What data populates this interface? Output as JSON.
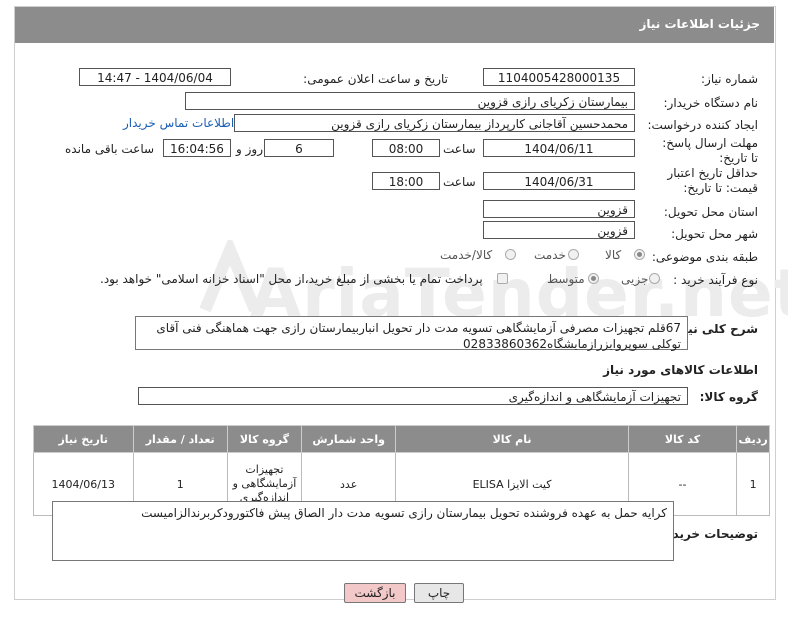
{
  "header": {
    "title": "جزئیات اطلاعات نیاز"
  },
  "watermark": "AriaTender.net",
  "form": {
    "need_number_label": "شماره نیاز:",
    "need_number": "1104005428000135",
    "announce_label": "تاریخ و ساعت اعلان عمومی:",
    "announce_value": "1404/06/04 - 14:47",
    "buyer_org_label": "نام دستگاه خریدار:",
    "buyer_org": "بیمارستان زکریای رازی قزوین",
    "creator_label": "ایجاد کننده درخواست:",
    "creator": "محمدحسین آقاجانی کارپرداز بیمارستان زکریای رازی قزوین",
    "contact_link": "اطلاعات تماس خریدار",
    "reply_deadline_label": "مهلت ارسال پاسخ: تا تاریخ:",
    "reply_date": "1404/06/11",
    "time_label": "ساعت",
    "reply_time": "08:00",
    "days_value": "6",
    "days_label": "روز و",
    "remaining_time": "16:04:56",
    "remaining_label": "ساعت باقی مانده",
    "price_deadline_label": "حداقل تاریخ اعتبار قیمت: تا تاریخ:",
    "price_date": "1404/06/31",
    "price_time": "18:00",
    "province_label": "استان محل تحویل:",
    "province": "قزوین",
    "city_label": "شهر محل تحویل:",
    "city": "قزوین",
    "category_label": "طبقه بندی موضوعی:",
    "category_options": [
      "کالا",
      "خدمت",
      "کالا/خدمت"
    ],
    "process_label": "نوع فرآیند خرید :",
    "process_options": [
      "جزیی",
      "متوسط"
    ],
    "payment_note": "پرداخت تمام یا بخشی از مبلغ خرید،از محل \"اسناد خزانه اسلامی\" خواهد بود."
  },
  "description": {
    "label": "شرح کلی نیاز:",
    "text": "67قلم تجهیزات مصرفی آزمایشگاهی تسویه مدت دار تحویل  انباربیمارستان رازی جهت هماهنگی فنی آقای توکلی سوپروایزرازمایشگاه02833860362"
  },
  "goods_info": {
    "section_title": "اطلاعات کالاهای مورد نیاز",
    "group_label": "گروه کالا:",
    "group_value": "تجهیزات آزمایشگاهی و اندازه‌گیری"
  },
  "table": {
    "headers": [
      "ردیف",
      "کد کالا",
      "نام کالا",
      "واحد شمارش",
      "گروه کالا",
      "تعداد / مقدار",
      "تاریخ نیاز"
    ],
    "rows": [
      {
        "row": "1",
        "code": "--",
        "name": "کیت الایزا ELISA",
        "unit": "عدد",
        "group": "تجهیزات آزمایشگاهی و اندازه‌گیری",
        "qty": "1",
        "date": "1404/06/13"
      }
    ]
  },
  "buyer_notes": {
    "label": "توضیحات خریدار:",
    "text": "کرایه حمل به عهده فروشنده تحویل بیمارستان رازی تسویه مدت دار الصاق پیش فاکتورودکربرندالزامیست"
  },
  "buttons": {
    "print": "چاپ",
    "back": "بازگشت"
  },
  "colors": {
    "header_bg": "#8c8c8c",
    "link": "#1a5fb4",
    "back_button_bg": "#f3c8c8"
  }
}
